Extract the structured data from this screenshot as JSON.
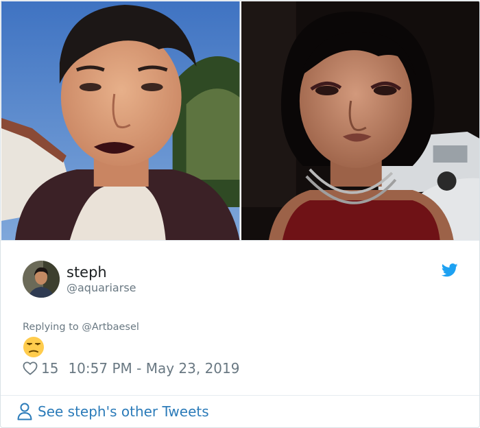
{
  "tweet": {
    "display_name": "steph",
    "handle": "@aquariarse",
    "replying_prefix": "Replying to ",
    "replying_to": "@Artbaesel",
    "emoji": "😒",
    "likes": "15",
    "timestamp": "10:57 PM - May 23, 2019"
  },
  "footer": {
    "other_tweets_label": "See steph's other Tweets"
  },
  "icons": {
    "brand": "twitter-bird-icon",
    "like": "heart-icon",
    "profile": "user-icon"
  },
  "colors": {
    "link": "#2b7bb9",
    "twitter_blue": "#1da1f2",
    "muted": "#697882",
    "text": "#1c2022"
  }
}
